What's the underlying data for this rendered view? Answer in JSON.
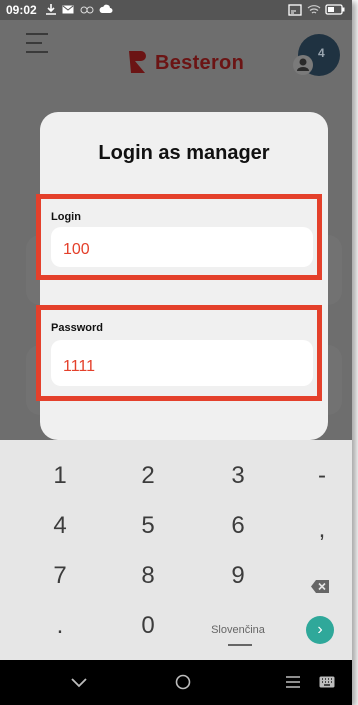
{
  "status_bar": {
    "time": "09:02"
  },
  "header": {
    "brand": "Besteron",
    "notification_count": "4"
  },
  "dialog": {
    "title": "Login as manager",
    "login": {
      "label": "Login",
      "value": "100"
    },
    "password": {
      "label": "Password",
      "value": "1111"
    }
  },
  "keyboard": {
    "keys": {
      "k1": "1",
      "k2": "2",
      "k3": "3",
      "kminus": "-",
      "k4": "4",
      "k5": "5",
      "k6": "6",
      "kcomma": ",",
      "k7": "7",
      "k8": "8",
      "k9": "9",
      "kdot": ".",
      "k0": "0"
    },
    "language": "Slovenčina"
  },
  "colors": {
    "accent_red": "#e4402b",
    "go_button": "#2fa89a",
    "brand_red": "#6b1414"
  },
  "icons": {
    "status": [
      "download-icon",
      "mail-icon",
      "sync-icon",
      "cloud-icon",
      "cast-icon",
      "wifi-icon",
      "battery-icon"
    ],
    "header": [
      "menu-icon",
      "besteron-logo-icon",
      "user-icon"
    ],
    "keyboard": [
      "backspace-icon",
      "go-arrow-icon"
    ],
    "nav": [
      "chevron-down-icon",
      "home-circle-icon",
      "menu-icon",
      "keyboard-icon"
    ]
  }
}
